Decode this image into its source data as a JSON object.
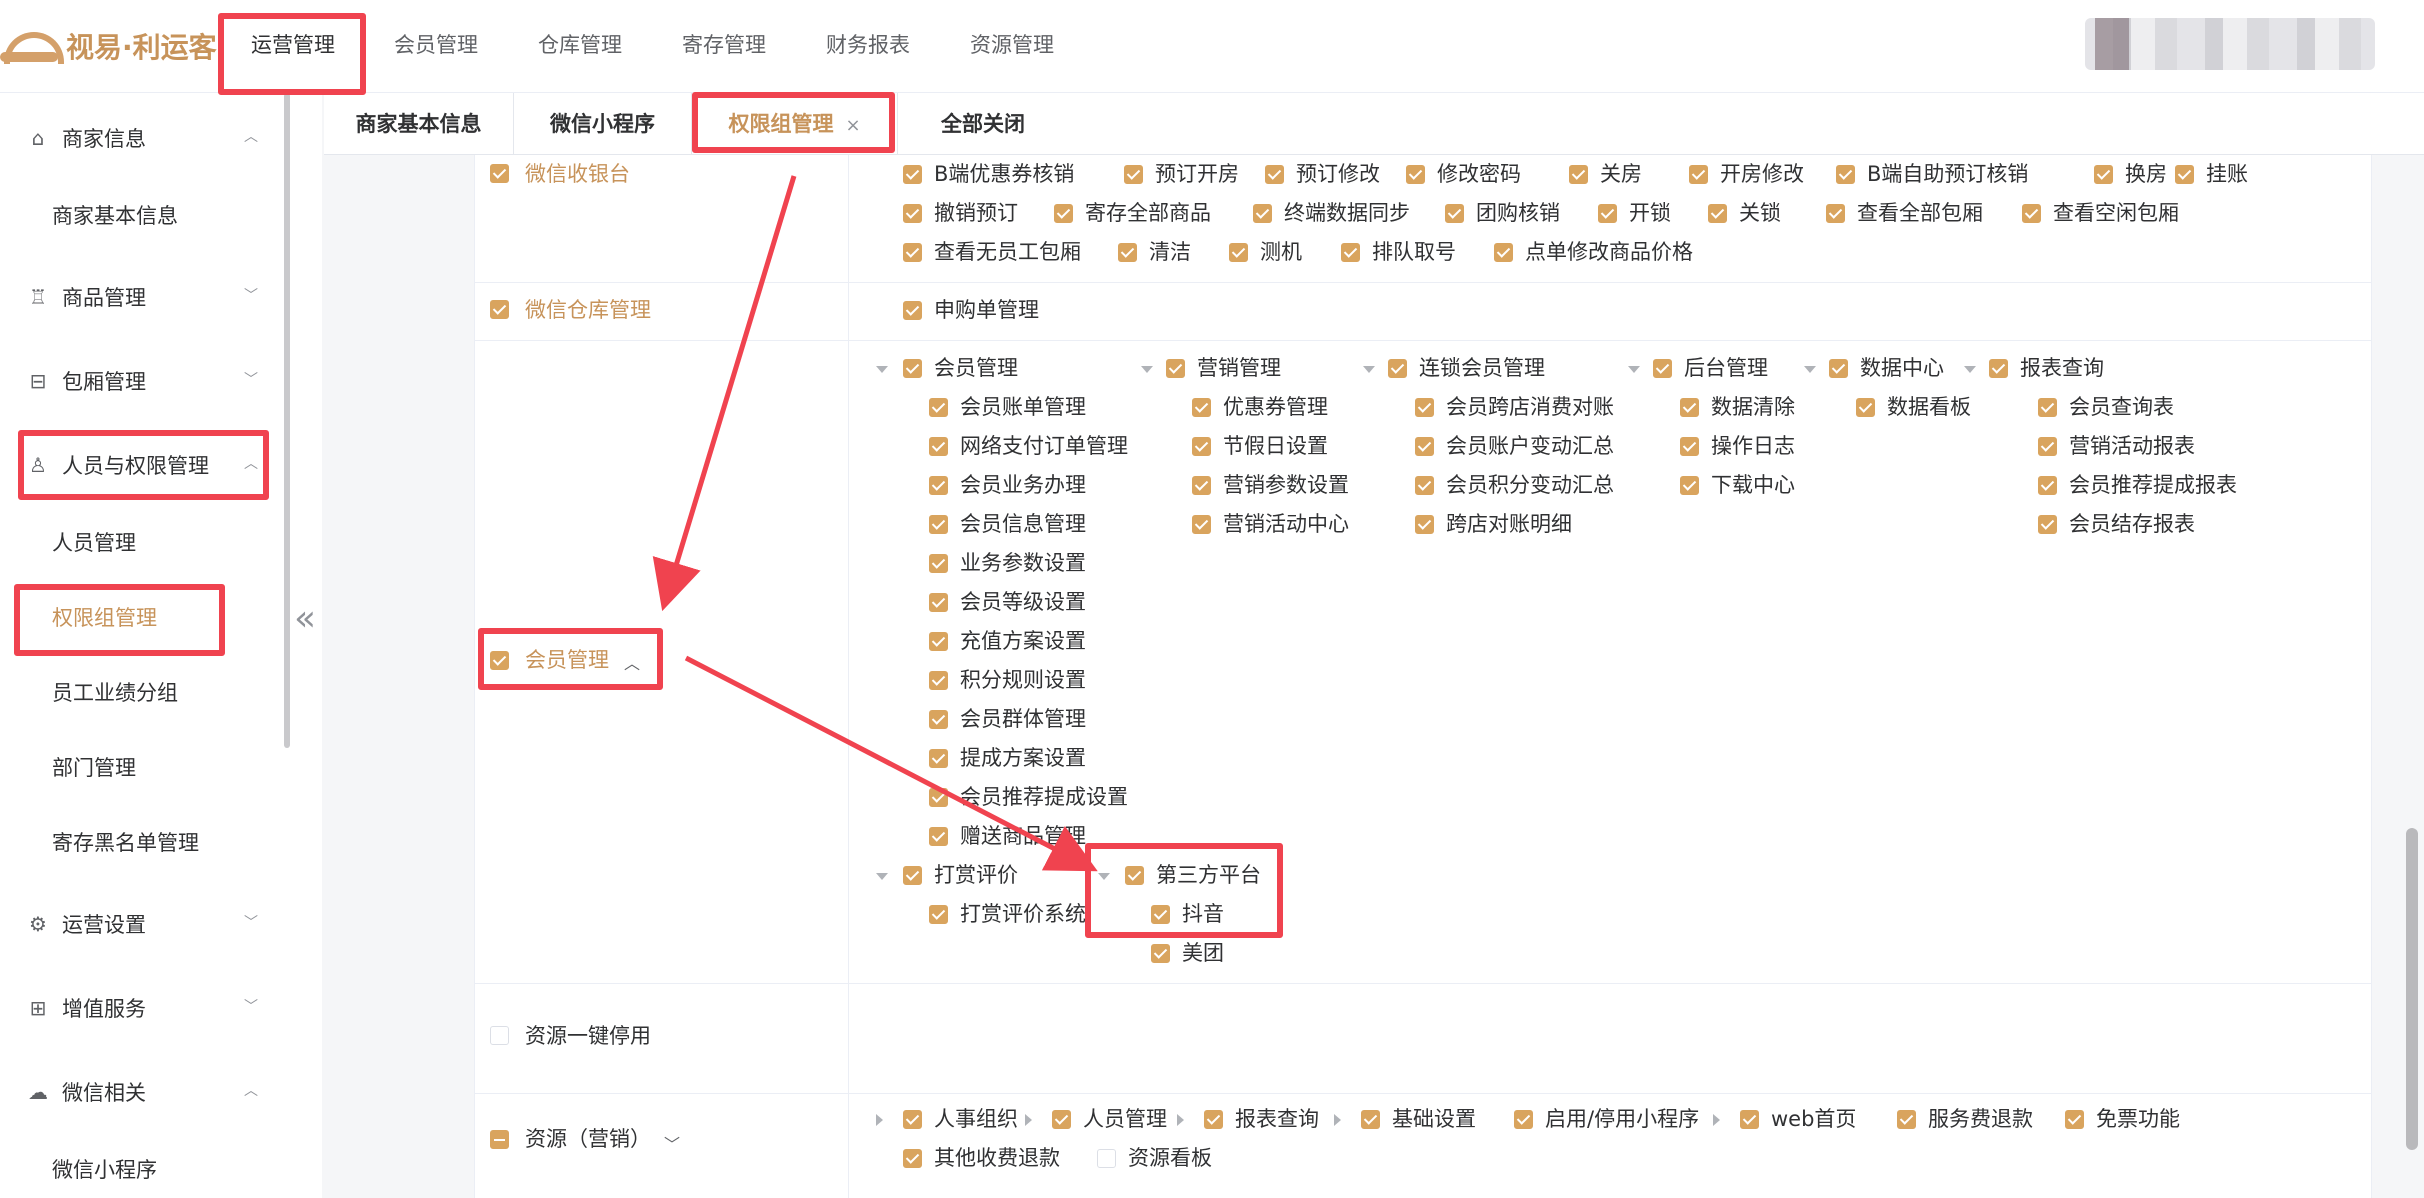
{
  "logo": {
    "text": "视易·利运客"
  },
  "top_nav": [
    "运营管理",
    "会员管理",
    "仓库管理",
    "寄存管理",
    "财务报表",
    "资源管理"
  ],
  "sidebar": {
    "groups": {
      "merchant": "商家信息",
      "goods": "商品管理",
      "room": "包厢管理",
      "staff": "人员与权限管理",
      "ops": "运营设置",
      "value": "增值服务",
      "wechat": "微信相关"
    },
    "subs": {
      "merchant_basic": "商家基本信息",
      "staff_mgmt": "人员管理",
      "perm_group": "权限组管理",
      "perf_group": "员工业绩分组",
      "dept": "部门管理",
      "blacklist": "寄存黑名单管理",
      "miniprogram": "微信小程序"
    }
  },
  "tabs": [
    "商家基本信息",
    "微信小程序",
    "权限组管理",
    "全部关闭"
  ],
  "modules": {
    "wx_cashier": "微信收银台",
    "wx_warehouse": "微信仓库管理",
    "member": "会员管理",
    "res_stop": "资源一键停用",
    "res_marketing": "资源（营销）"
  },
  "cashier_perms": [
    "B端优惠券核销",
    "预订开房",
    "预订修改",
    "修改密码",
    "关房",
    "开房修改",
    "B端自助预订核销",
    "换房",
    "挂账",
    "撤销预订",
    "寄存全部商品",
    "终端数据同步",
    "团购核销",
    "开锁",
    "关锁",
    "查看全部包厢",
    "查看空闲包厢",
    "查看无员工包厢",
    "清洁",
    "测机",
    "排队取号",
    "点单修改商品价格"
  ],
  "warehouse_perms": [
    "申购单管理"
  ],
  "member_tree": {
    "member_mgmt": {
      "label": "会员管理",
      "items": [
        "会员账单管理",
        "网络支付订单管理",
        "会员业务办理",
        "会员信息管理",
        "业务参数设置",
        "会员等级设置",
        "充值方案设置",
        "积分规则设置",
        "会员群体管理",
        "提成方案设置",
        "会员推荐提成设置",
        "赠送商品管理"
      ]
    },
    "marketing": {
      "label": "营销管理",
      "items": [
        "优惠券管理",
        "节假日设置",
        "营销参数设置",
        "营销活动中心"
      ]
    },
    "chain": {
      "label": "连锁会员管理",
      "items": [
        "会员跨店消费对账",
        "会员账户变动汇总",
        "会员积分变动汇总",
        "跨店对账明细"
      ]
    },
    "backend": {
      "label": "后台管理",
      "items": [
        "数据清除",
        "操作日志",
        "下载中心"
      ]
    },
    "data_center": {
      "label": "数据中心",
      "items": [
        "数据看板"
      ]
    },
    "reports": {
      "label": "报表查询",
      "items": [
        "会员查询表",
        "营销活动报表",
        "会员推荐提成报表",
        "会员结存报表"
      ]
    },
    "reward": {
      "label": "打赏评价",
      "items": [
        "打赏评价系统"
      ]
    },
    "third_party": {
      "label": "第三方平台",
      "items": [
        "抖音",
        "美团"
      ]
    }
  },
  "marketing_perms": {
    "checked": [
      "人事组织",
      "人员管理",
      "报表查询",
      "基础设置",
      "启用/停用小程序",
      "web首页",
      "服务费退款",
      "免票功能",
      "其他收费退款"
    ],
    "unchecked": [
      "资源看板"
    ]
  },
  "colors": {
    "accent": "#c7935a",
    "checkbox": "#d9a45e",
    "highlight": "#f0434f"
  }
}
